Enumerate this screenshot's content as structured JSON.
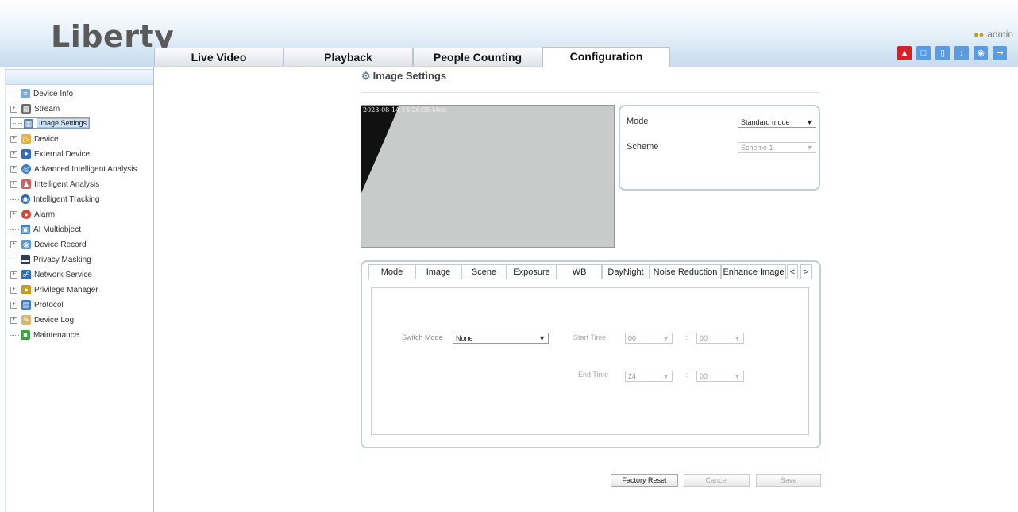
{
  "app": {
    "logo": "Liberty"
  },
  "nav": {
    "tabs": [
      "Live Video",
      "Playback",
      "People Counting",
      "Configuration"
    ],
    "active": "Configuration"
  },
  "user": {
    "name": "admin"
  },
  "toolbar": {
    "icons": [
      "alarm-icon",
      "snapshot-icon",
      "file-icon",
      "download-icon",
      "lock-icon",
      "logout-icon"
    ]
  },
  "sidebar": {
    "items": [
      {
        "label": "Device Info",
        "icon": "info-icon",
        "expandable": false
      },
      {
        "label": "Stream",
        "icon": "stream-icon",
        "expandable": true
      },
      {
        "label": "Image Settings",
        "icon": "image-icon",
        "expandable": false,
        "selected": true
      },
      {
        "label": "Device",
        "icon": "device-icon",
        "expandable": true
      },
      {
        "label": "External Device",
        "icon": "external-device-icon",
        "expandable": true
      },
      {
        "label": "Advanced Intelligent Analysis",
        "icon": "analysis-icon",
        "expandable": true
      },
      {
        "label": "Intelligent Analysis",
        "icon": "person-icon",
        "expandable": true
      },
      {
        "label": "Intelligent Tracking",
        "icon": "tracking-icon",
        "expandable": false
      },
      {
        "label": "Alarm",
        "icon": "alarm-icon",
        "expandable": true
      },
      {
        "label": "AI Multiobject",
        "icon": "ai-icon",
        "expandable": false
      },
      {
        "label": "Device Record",
        "icon": "record-icon",
        "expandable": true
      },
      {
        "label": "Privacy Masking",
        "icon": "privacy-icon",
        "expandable": false
      },
      {
        "label": "Network Service",
        "icon": "network-icon",
        "expandable": true
      },
      {
        "label": "Privilege Manager",
        "icon": "users-icon",
        "expandable": true
      },
      {
        "label": "Protocol",
        "icon": "protocol-icon",
        "expandable": true
      },
      {
        "label": "Device Log",
        "icon": "log-icon",
        "expandable": true
      },
      {
        "label": "Maintenance",
        "icon": "maintenance-icon",
        "expandable": false
      }
    ]
  },
  "page": {
    "title": "Image Settings"
  },
  "video": {
    "osd": "2023-08-14 15:26:55 Mon"
  },
  "settings": {
    "mode_label": "Mode",
    "mode_value": "Standard mode",
    "scheme_label": "Scheme",
    "scheme_value": "Scheme 1"
  },
  "subtabs": [
    "Mode",
    "Image",
    "Scene",
    "Exposure",
    "WB",
    "DayNight",
    "Noise Reduction",
    "Enhance Image",
    "<",
    ">"
  ],
  "mode_panel": {
    "switch_mode_label": "Switch Mode",
    "switch_mode_value": "None",
    "start_time_label": "Start Time",
    "start_hour": "00",
    "start_min": "00",
    "end_time_label": "End Time",
    "end_hour": "24",
    "end_min": "00",
    "colon": ":"
  },
  "buttons": {
    "factory_reset": "Factory Reset",
    "cancel": "Cancel",
    "save": "Save"
  },
  "colors": {
    "accent": "#5b9ce0",
    "alarm": "#d81f26",
    "header_gradient_end": "#c6dcef"
  }
}
